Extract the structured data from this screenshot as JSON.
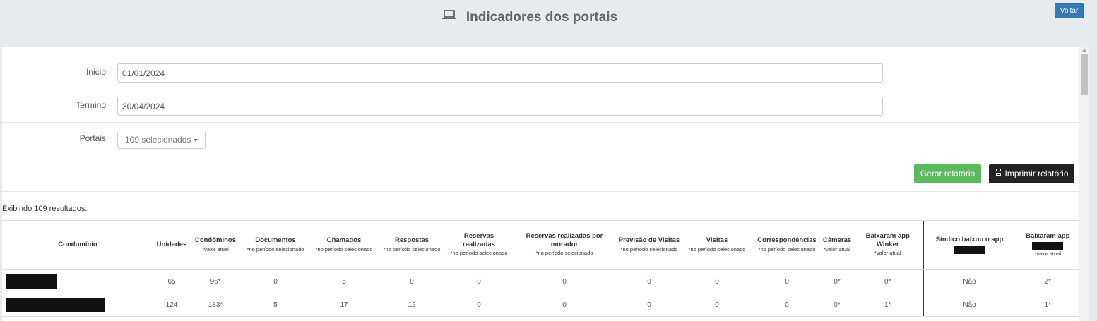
{
  "header": {
    "title": "Indicadores dos portais",
    "title_icon": "laptop-icon",
    "back_label": "Voltar",
    "accent": "#337ab7"
  },
  "form": {
    "inicio_label": "Inicio",
    "inicio_value": "01/01/2024",
    "termino_label": "Termino",
    "termino_value": "30/04/2024",
    "portais_label": "Portais",
    "portais_value": "109 selecionados"
  },
  "actions": {
    "generate_label": "Gerar relatório",
    "print_label": "Imprimir relatório",
    "print_icon": "print-icon",
    "generate_color": "#5cb85c",
    "print_color": "#222222"
  },
  "results_text": "Exibindo 109 resultados.",
  "table": {
    "columns": [
      {
        "label": "Condomínio",
        "sub": ""
      },
      {
        "label": "Unidades",
        "sub": ""
      },
      {
        "label": "Condôminos",
        "sub": "*valor atual"
      },
      {
        "label": "Documentos",
        "sub": "*no período selecionado"
      },
      {
        "label": "Chamados",
        "sub": "*no período selecionado"
      },
      {
        "label": "Respostas",
        "sub": "*no período selecionado"
      },
      {
        "label": "Reservas realizadas",
        "sub": "*no período selecionado"
      },
      {
        "label": "Reservas realizadas por morador",
        "sub": "*no período selecionado"
      },
      {
        "label": "Previsão de Visitas",
        "sub": "*no período selecionado"
      },
      {
        "label": "Visitas",
        "sub": "*no período selecionado"
      },
      {
        "label": "Correspondências",
        "sub": "*no período selecionado"
      },
      {
        "label": "Câmeras",
        "sub": "*valor atual"
      },
      {
        "label": "Baixaram app Winker",
        "sub": "*valor atual"
      },
      {
        "label": "Síndico baixou o app",
        "sub": ""
      },
      {
        "label": "Baixaram app",
        "sub": "*valor atual"
      }
    ],
    "rows": [
      {
        "cells": [
          "65",
          "96*",
          "0",
          "5",
          "0",
          "0",
          "0",
          "0",
          "0",
          "0",
          "0*",
          "0*",
          "Não",
          "2*"
        ]
      },
      {
        "cells": [
          "124",
          "183*",
          "5",
          "17",
          "12",
          "0",
          "0",
          "0",
          "0",
          "0",
          "0*",
          "1*",
          "Não",
          "1*"
        ]
      }
    ]
  }
}
